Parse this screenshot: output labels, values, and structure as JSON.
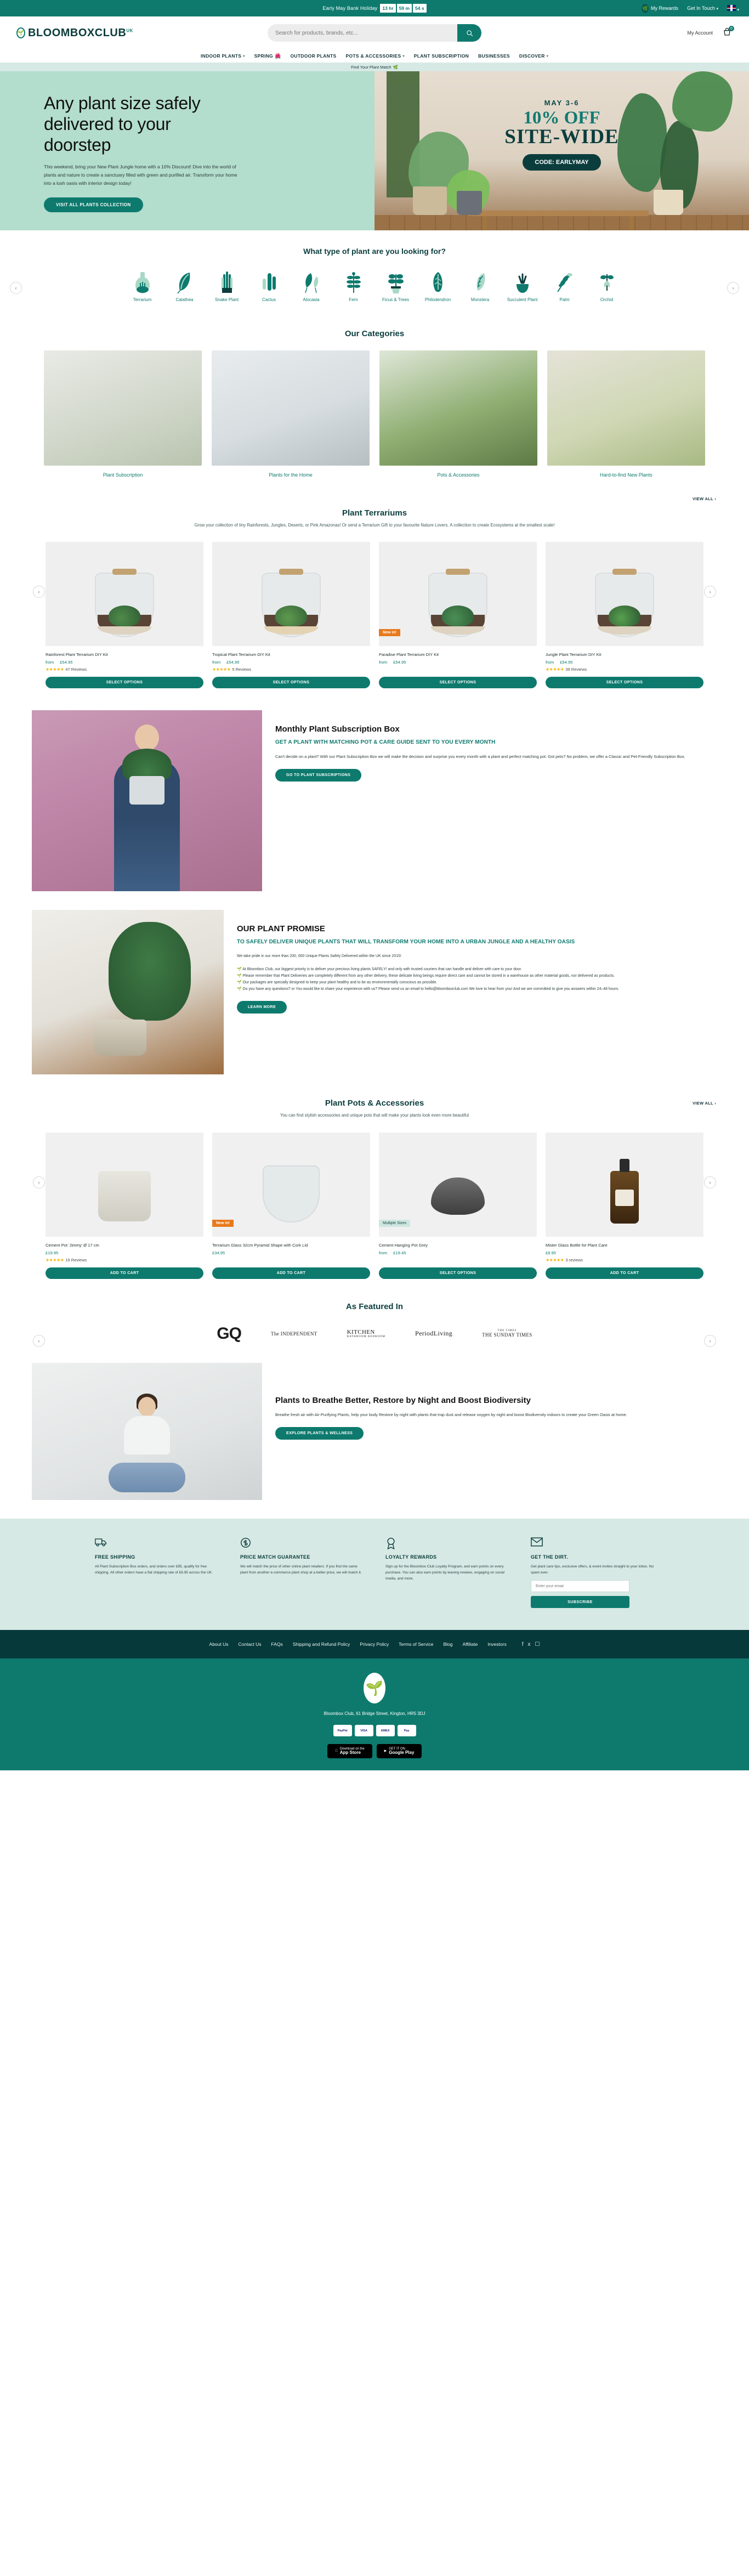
{
  "announcement": {
    "label": "Early May Bank Holiday",
    "countdown": [
      "13 hr",
      "59 m",
      "54 s"
    ],
    "rewards": "My Rewards",
    "contact": "Get In Touch",
    "flag_icon": "uk-flag-icon"
  },
  "header": {
    "logo": "BLOOMBOXCLUB",
    "logo_sup": "UK",
    "search_placeholder": "Search for products, brands, etc...",
    "account": "My Account",
    "cart_count": "0"
  },
  "nav": {
    "items": [
      {
        "label": "INDOOR PLANTS",
        "caret": true,
        "tulip": false
      },
      {
        "label": "SPRING",
        "caret": false,
        "tulip": true
      },
      {
        "label": "OUTDOOR PLANTS",
        "caret": false,
        "tulip": false
      },
      {
        "label": "POTS & ACCESSORIES",
        "caret": true,
        "tulip": false
      },
      {
        "label": "PLANT SUBSCRIPTION",
        "caret": false,
        "tulip": false
      },
      {
        "label": "BUSINESSES",
        "caret": false,
        "tulip": false
      },
      {
        "label": "DISCOVER",
        "caret": true,
        "tulip": false
      }
    ]
  },
  "findstrip": {
    "text": "Find Your Plant Match"
  },
  "hero": {
    "heading": "Any plant size safely delivered to your doorstep",
    "body": "This weekend, bring your New Plant Jungle home with a 10% Discount! Dive into the world of plants and nature to create a sanctuary filled with green and purified air. Transform your home into a lush oasis with interior design today!",
    "cta": "VISIT ALL PLANTS COLLECTION",
    "promo_date": "MAY 3-6",
    "promo_off": "10% OFF",
    "promo_sitewide": "SITE-WIDE",
    "promo_code": "CODE: EARLYMAY"
  },
  "picker": {
    "title": "What type of plant are you looking for?",
    "items": [
      {
        "label": "Terrarium",
        "icon": "terrarium-icon"
      },
      {
        "label": "Calathea",
        "icon": "calathea-leaf-icon"
      },
      {
        "label": "Snake Plant",
        "icon": "snake-plant-icon"
      },
      {
        "label": "Cactus",
        "icon": "cactus-icon"
      },
      {
        "label": "Alocasia",
        "icon": "alocasia-icon"
      },
      {
        "label": "Fern",
        "icon": "fern-icon"
      },
      {
        "label": "Ficus & Trees",
        "icon": "ficus-tree-icon"
      },
      {
        "label": "Philodendron",
        "icon": "philodendron-icon"
      },
      {
        "label": "Monstera",
        "icon": "monstera-icon"
      },
      {
        "label": "Succulent Plant",
        "icon": "succulent-icon"
      },
      {
        "label": "Palm",
        "icon": "palm-icon"
      },
      {
        "label": "Orchid",
        "icon": "orchid-icon"
      }
    ],
    "prev": "‹",
    "next": "›"
  },
  "categories": {
    "title": "Our Categories",
    "items": [
      {
        "label": "Plant Subscription"
      },
      {
        "label": "Plants for the Home"
      },
      {
        "label": "Pots & Accessories"
      },
      {
        "label": "Hard-to-find New Plants"
      }
    ]
  },
  "terrariums": {
    "title": "Plant Terrariums",
    "subtitle": "Grow your collection of tiny Rainforests, Jungles, Deserts, or Pink Amazonas! Or send a Terrarium Gift to your favourite Nature Lovers. A collection to create Ecosystems at the smallest scale!",
    "view_all": "VIEW ALL",
    "products": [
      {
        "name": "Rainforest Plant Terrarium DIY Kit",
        "from": "from",
        "price": "£54.95",
        "stars": "★★★★★",
        "reviews": "47 Reviews",
        "cta": "SELECT OPTIONS",
        "tag": ""
      },
      {
        "name": "Tropical Plant Terrarium DIY Kit",
        "from": "from",
        "price": "£54.95",
        "stars": "★★★★★",
        "reviews": "5 Reviews",
        "cta": "SELECT OPTIONS",
        "tag": ""
      },
      {
        "name": "Paradise Plant Terrarium DIY Kit",
        "from": "from",
        "price": "£54.95",
        "stars": "",
        "reviews": "",
        "cta": "SELECT OPTIONS",
        "tag": "New in!"
      },
      {
        "name": "Jungle Plant Terrarium DIY Kit",
        "from": "from",
        "price": "£54.95",
        "stars": "★★★★★",
        "reviews": "39 Reviews",
        "cta": "SELECT OPTIONS",
        "tag": ""
      }
    ]
  },
  "subscription": {
    "title": "Monthly Plant Subscription Box",
    "subtitle": "GET A PLANT WITH MATCHING POT & CARE GUIDE SENT TO YOU EVERY MONTH",
    "body": "Can't decide on a plant? With our Plant Subscription Box we will make the decision and surprise you every month with a plant and perfect matching pot. Got pets? No problem, we offer a Classic and Pet-Friendly Subscription Box.",
    "cta": "GO TO PLANT SUBSCRIPTIONS"
  },
  "promise": {
    "title": "OUR PLANT PROMISE",
    "subtitle": "TO SAFELY DELIVER UNIQUE PLANTS THAT WILL TRANSFORM YOUR HOME INTO A URBAN JUNGLE AND A HEALTHY OASIS",
    "intro": "We take pride in our more than 200, 000 Unique Plants Safely Delivered within the UK since 2015!",
    "bullets": [
      "At Bloombox Club, our biggest priority is to deliver your precious living plants SAFELY! and only with trusted couriers that can handle and deliver with care to your door.",
      "Please remember that Plant Deliveries are completely different from any other delivery, these delicate living beings require direct care and cannot be stored in a warehouse as other material goods, nor delivered as products.",
      "Our packages are specially designed to keep your plant healthy and to be as environmentally conscious as possible.",
      "Do you have any questions? or You would like to share your experience with us? Please send us an email to hello@bloomboxclub.com We love to hear from you! And we are committed to give you answers within 24–48 hours."
    ],
    "cta": "LEARN MORE"
  },
  "pots": {
    "title": "Plant Pots & Accessories",
    "subtitle": "You can find stylish accessories and unique pots that will make your plants look even more beautiful",
    "view_all": "VIEW ALL",
    "products": [
      {
        "name": "Cement Pot 'Jimmy' Ø 17 cm",
        "price": "£19.95",
        "stars": "★★★★★",
        "reviews": "15 Reviews",
        "cta": "ADD TO CART",
        "tag": ""
      },
      {
        "name": "Terrarium Glass 32cm Pyramid Shape with Cork Lid",
        "price": "£34.95",
        "stars": "",
        "reviews": "",
        "cta": "ADD TO CART",
        "tag": "New in!"
      },
      {
        "name": "Cement Hanging Pot Grey",
        "from": "from",
        "price": "£19.45",
        "stars": "",
        "reviews": "",
        "cta": "SELECT OPTIONS",
        "tag": "Multiple Sizes"
      },
      {
        "name": "Mister Glass Bottle for Plant Care",
        "price": "£8.95",
        "stars": "★★★★★",
        "reviews": "3 reviews",
        "cta": "ADD TO CART",
        "tag": ""
      }
    ]
  },
  "featured": {
    "title": "As Featured In",
    "brands": [
      {
        "name": "GQ"
      },
      {
        "name": "The INDEPENDENT"
      },
      {
        "name": "KITCHEN",
        "sub": "BATHROOM BEDROOM"
      },
      {
        "name": "PeriodLiving"
      },
      {
        "name": "THE SUNDAY TIMES",
        "sub": "THE TIMES"
      }
    ]
  },
  "biodiversity": {
    "title": "Plants to Breathe Better, Restore by Night and Boost Biodiversity",
    "body": "Breathe fresh air with Air-Purifying Plants, help your body Restore by night with plants that trap dust and release oxygen by night and boost Biodiversity indoors to create your Green Oasis at home.",
    "cta": "EXPLORE PLANTS & WELLNESS"
  },
  "value_props": [
    {
      "icon": "truck-icon",
      "heading": "FREE SHIPPING",
      "body": "All Plant Subscription Box orders, and orders over £85, qualify for free shipping. All other orders have a flat shipping rate of £6.95 across the UK."
    },
    {
      "icon": "tag-icon",
      "heading": "PRICE MATCH GUARANTEE",
      "body": "We will match the price of other online plant retailers. If you find the same plant from another e-commerce plant shop at a better price, we will match it."
    },
    {
      "icon": "medal-icon",
      "heading": "LOYALTY REWARDS",
      "body": "Sign up for the Bloombox Club Loyalty Program, and earn points on every purchase. You can also earn points by leaving reviews, engaging on social media, and more."
    },
    {
      "icon": "mail-icon",
      "heading": "GET THE DIRT.",
      "body": "Get plant care tips, exclusive offers, & event invites straight to your inbox. No spam ever.",
      "placeholder": "Enter your email",
      "button": "SUBSCRIBE"
    }
  ],
  "footer": {
    "links": [
      "About Us",
      "Contact Us",
      "FAQs",
      "Shipping and Refund Policy",
      "Privacy Policy",
      "Terms of Service",
      "Blog",
      "Affiliate",
      "Investors"
    ],
    "socials": [
      "facebook-icon",
      "pinterest-icon",
      "instagram-icon"
    ],
    "address": "Bloombox Club, 61 Bridge Street, Kington, HR5 3DJ",
    "payments": [
      "PayPal",
      "VISA",
      "AMEX",
      "Pay"
    ],
    "stores": [
      {
        "small": "Download on the",
        "big": "App Store"
      },
      {
        "small": "GET IT ON",
        "big": "Google Play"
      }
    ]
  }
}
